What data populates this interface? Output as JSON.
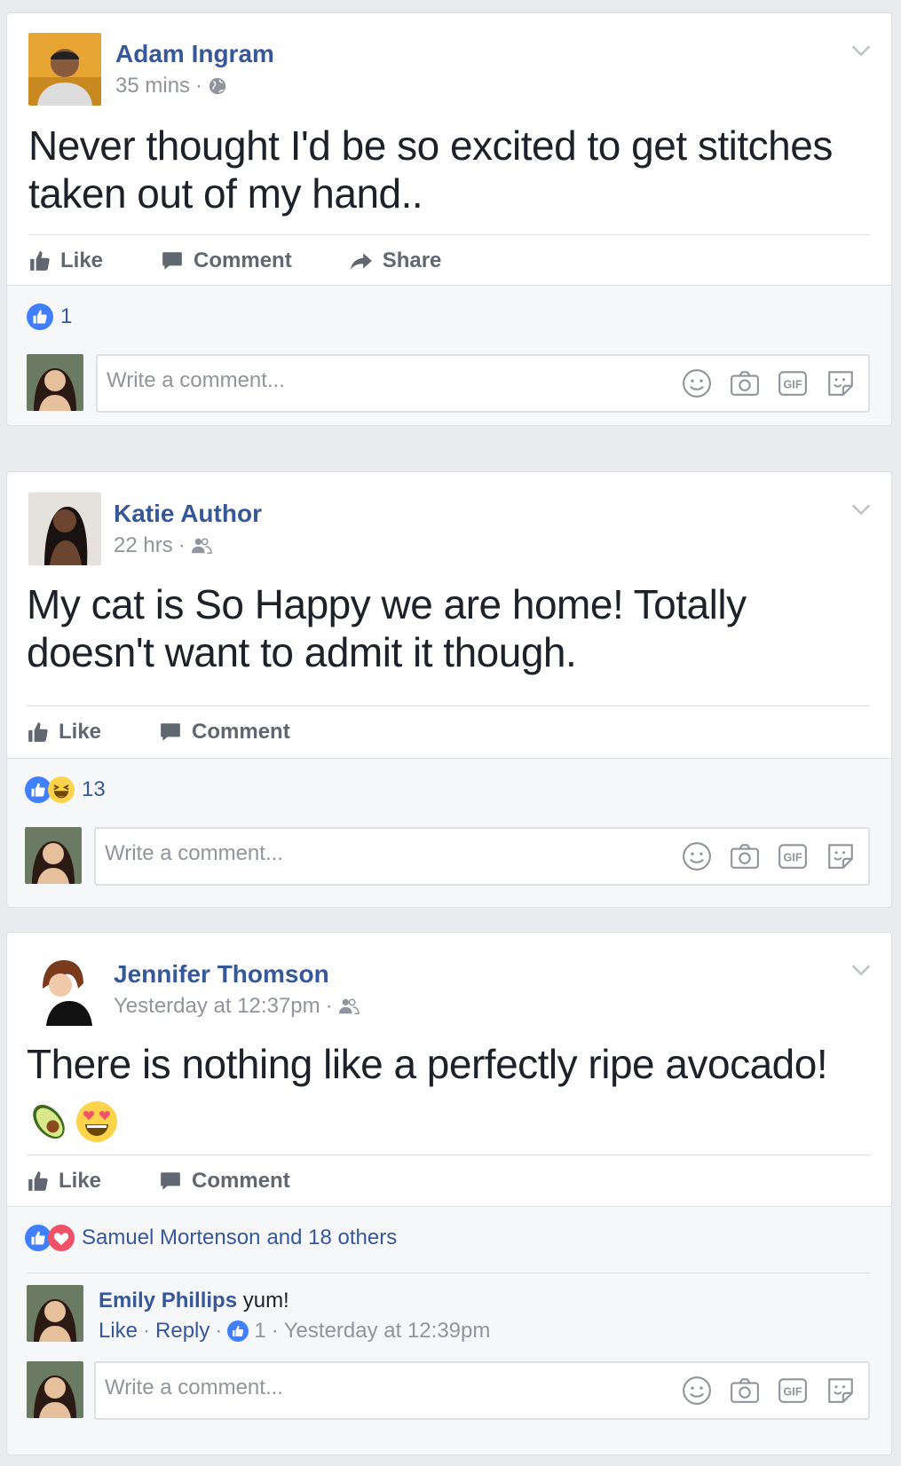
{
  "posts": [
    {
      "author": "Adam Ingram",
      "time": "35 mins",
      "privacy_icon": "globe-icon",
      "text_line1": "Never thought I'd be so excited to get stitches",
      "text_line2": "taken out of my hand..",
      "actions": {
        "like": "Like",
        "comment": "Comment",
        "share": "Share"
      },
      "reaction_count": "1",
      "comment_placeholder": "Write a comment..."
    },
    {
      "author": "Katie Author",
      "time": "22 hrs",
      "privacy_icon": "friends-icon",
      "text_line1": "My cat is So Happy we are home! Totally",
      "text_line2": "doesn't want to admit it though.",
      "actions": {
        "like": "Like",
        "comment": "Comment"
      },
      "reaction_count": "13",
      "comment_placeholder": "Write a comment..."
    },
    {
      "author": "Jennifer Thomson",
      "time": "Yesterday at 12:37pm",
      "privacy_icon": "friends-icon",
      "text_line1": "There is nothing like a perfectly ripe avocado!",
      "emoji": [
        "avocado",
        "heart-eyes"
      ],
      "actions": {
        "like": "Like",
        "comment": "Comment"
      },
      "reaction_name": "Samuel Mortenson",
      "reaction_rest": "and 18 others",
      "comment": {
        "author": "Emily Phillips",
        "text": "yum!",
        "like": "Like",
        "reply": "Reply",
        "likes": "1",
        "time": "Yesterday at 12:39pm"
      },
      "comment_placeholder": "Write a comment..."
    }
  ],
  "colors": {
    "link": "#365899",
    "like_blue": "#4080ff",
    "love_red": "#f25268",
    "haha_yellow": "#fcd34a"
  }
}
